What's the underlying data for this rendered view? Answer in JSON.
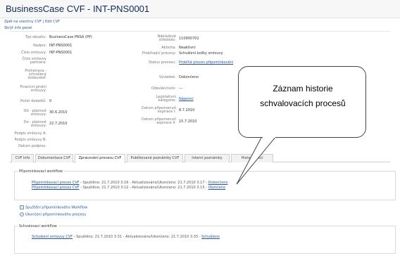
{
  "header": {
    "app_title": "BusinessCase CVF",
    "doc_title": "- INT-PNS0001"
  },
  "toplinks": {
    "back": "Zpět na všechny CVF",
    "sep": "|",
    "edit": "Edit CVF"
  },
  "hide_info": "Skrýt info panel",
  "left_fields": [
    {
      "label": "Typ obsahu:",
      "value": "BusinessCase PNSA (PP)"
    },
    {
      "label": "Nadpis:",
      "value": "INT-PNS0001"
    },
    {
      "label": "Číslo smlouvy:",
      "value": "INT-PNS0001"
    },
    {
      "label": "Číslo smlouvy partnera:",
      "value": ""
    },
    {
      "label": "Protistrana - schválený dodavatel:",
      "value": ""
    },
    {
      "label": "Finanční plnění smlouvy:",
      "value": ""
    },
    {
      "label": "Počet dodatků:",
      "value": "0"
    },
    {
      "label": "Od - platnost smlouvy:",
      "value": "30.6.2010"
    },
    {
      "label": "Do - platnost smlouvy:",
      "value": "22.7.2010"
    },
    {
      "label": "Podpis smlouvy A:",
      "value": ""
    },
    {
      "label": "Podpis smlouvy B:",
      "value": ""
    },
    {
      "label": "Datum podpisu:",
      "value": ""
    }
  ],
  "right_fields": [
    {
      "label": "Nákladové středisko:",
      "value": "110900702",
      "link": false
    },
    {
      "label": "Aktivita:",
      "value": "Neaktivní",
      "link": false
    },
    {
      "label": "Probíhající procesy:",
      "value": "Schválení kolíky smlouvy",
      "link": false
    },
    {
      "label": "Status procesu:",
      "value": "Probíhá proces připomínkování",
      "link": true
    },
    {
      "label": "Výsledek:",
      "value": "Dokončeno",
      "link": false
    },
    {
      "label": "Odeslán/nuto:",
      "value": "---",
      "link": false
    },
    {
      "label": "Legislativní kategorie:",
      "value": "Nájemní",
      "link": true
    },
    {
      "label": "Datum připomenutí expirace I:",
      "value": "8.7.2010",
      "link": false
    },
    {
      "label": "Datum připomenutí expirace II:",
      "value": "15.7.2010",
      "link": false
    }
  ],
  "tabs": [
    {
      "label": "CVF Info",
      "active": false
    },
    {
      "label": "Dokumentace CVF",
      "active": false
    },
    {
      "label": "Zpracování procesu CVF",
      "active": true
    },
    {
      "label": "Publikované poznámky CVF",
      "active": false
    },
    {
      "label": "Interní poznámky",
      "active": false
    },
    {
      "label": "Historie akcí",
      "active": false
    }
  ],
  "review_workflow": {
    "title": "Připomínkovací workflow",
    "lines": [
      {
        "name": "Připomínkovací proces CVF",
        "meta": " - Spuštěno: 21.7.2010 3:16 - Aktualizováno/Ukončeno: 21.7.2010 3:17 - ",
        "status": "Dokončeno"
      },
      {
        "name": "Připomínkovací proces CVF",
        "meta": " - Spuštěno: 21.7.2010 3:12 - Aktualizováno/Ukončeno: 21.7.2010 3:15 - ",
        "status": "Ukončeno"
      }
    ]
  },
  "actions": {
    "start": "Spuštění připomínkového Workflow",
    "end": "Ukončení připomínkového procesu"
  },
  "approval_workflow": {
    "title": "Schvalovací workflow",
    "lines": [
      {
        "name": "Schválení smlouvy CVF",
        "meta": " - Spuštěno: 21.7.2010 3:31 - Aktualizováno/Ukončeno: 21.7.2010 3:33 - ",
        "status": "Schváleno"
      }
    ]
  },
  "callout": {
    "line1": "Záznam historie",
    "line2": "schvalovacích procesů"
  }
}
